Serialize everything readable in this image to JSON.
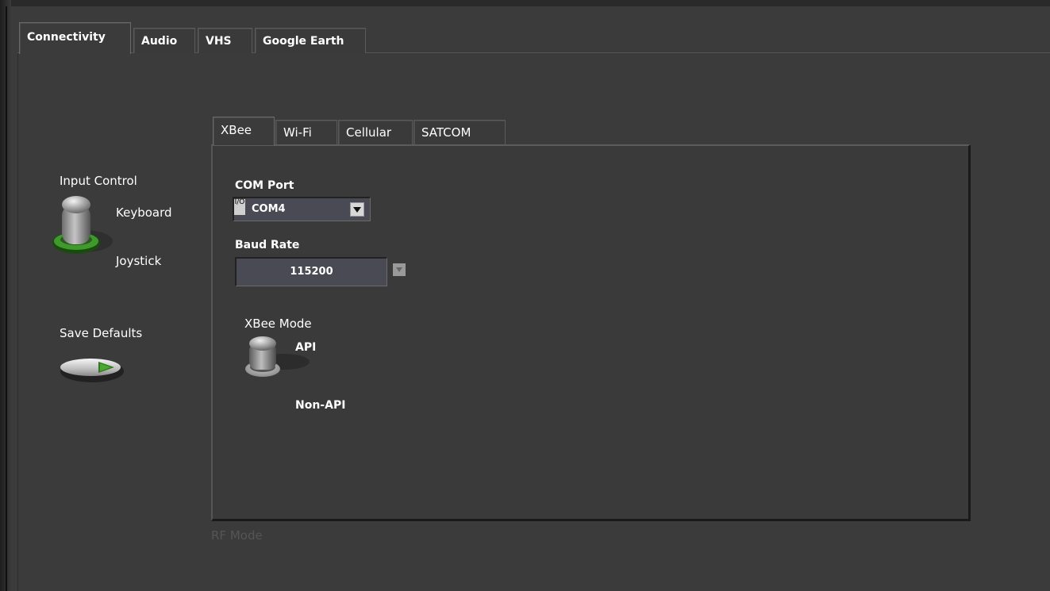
{
  "tabs": [
    "Connectivity",
    "Audio",
    "VHS",
    "Google Earth"
  ],
  "subtabs": [
    "XBee",
    "Wi-Fi",
    "Cellular",
    "SATCOM"
  ],
  "input_control": {
    "label": "Input Control",
    "option_top": "Keyboard",
    "option_bottom": "Joystick"
  },
  "save_defaults": {
    "label": "Save Defaults"
  },
  "com_port": {
    "label": "COM Port",
    "value": "COM4",
    "io_icon_text": "I/O"
  },
  "baud_rate": {
    "label": "Baud Rate",
    "value": "115200"
  },
  "xbee_mode": {
    "label": "XBee Mode",
    "option_top": "API",
    "option_bottom": "Non-API"
  },
  "rf_mode_label": "RF Mode",
  "colors": {
    "background": "#3b3b3b",
    "led_green": "#3e9a2a",
    "field_bg": "#4a4a55"
  }
}
